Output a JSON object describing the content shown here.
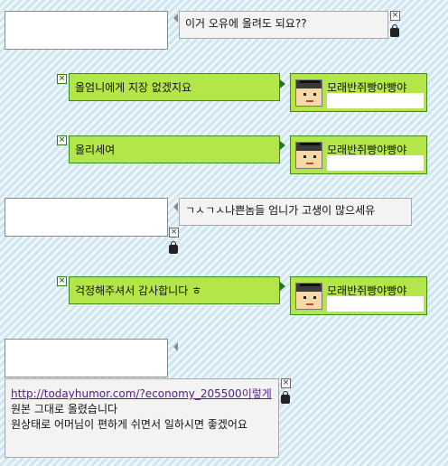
{
  "rows": [
    {
      "type": "reply",
      "text": "이거 오유에 올려도 되요??"
    },
    {
      "type": "mine",
      "text": "올엄니에게 지장 없겠지요",
      "name": "모래반쥐빵야빵야"
    },
    {
      "type": "mine",
      "text": "올리세여",
      "name": "모래반쥐빵야빵야"
    },
    {
      "type": "reply",
      "text": "ㄱㅅㄱㅅ나쁜놈들 엄니가 고생이 많으세유"
    },
    {
      "type": "mine",
      "text": "걱정해주셔서 감사합니다 ㅎ",
      "name": "모래반쥐빵야빵야"
    },
    {
      "type": "reply",
      "link": "http://todayhumor.com/?economy_205500",
      "link_tail": "이렇게",
      "text_after_link": " 원본 그대로 올렸습니다",
      "text_line2": "원상태로 어머님이 편하게 쉬면서 일하시면 좋겠어요"
    }
  ],
  "icons": {
    "close": "×"
  },
  "colors": {
    "green_bubble": "#b4e64a",
    "green_border": "#3b8a1d",
    "gray_bubble": "#f3f3f3"
  }
}
